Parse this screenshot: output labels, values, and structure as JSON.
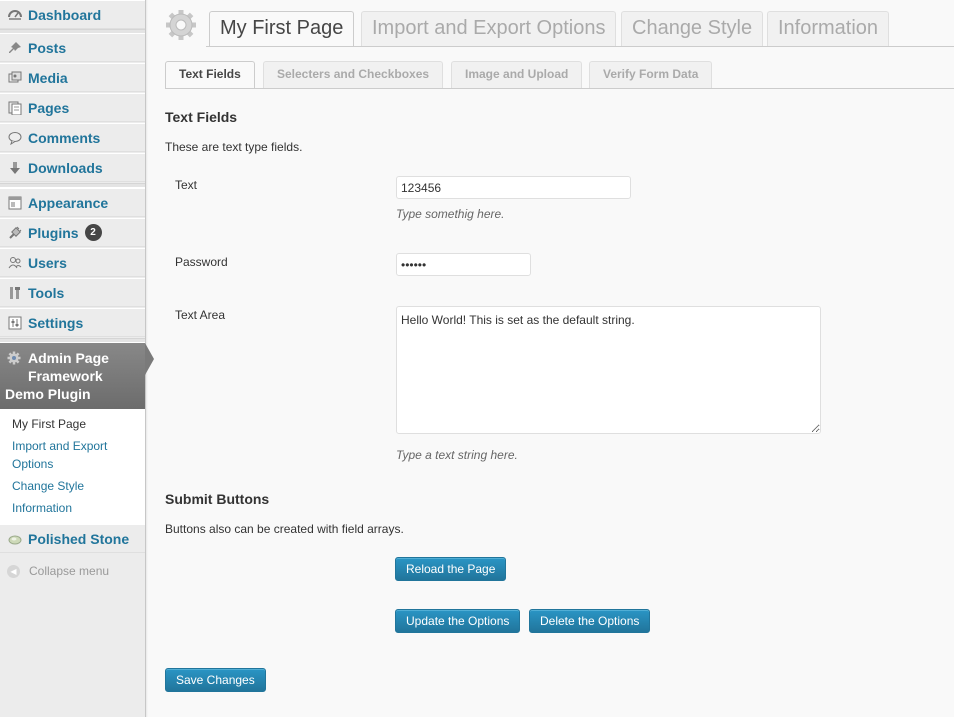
{
  "sidebar": {
    "items": [
      {
        "label": "Dashboard",
        "icon": "dashboard-icon"
      },
      {
        "label": "Posts",
        "icon": "pushpin-icon"
      },
      {
        "label": "Media",
        "icon": "media-icon"
      },
      {
        "label": "Pages",
        "icon": "pages-icon"
      },
      {
        "label": "Comments",
        "icon": "comment-icon"
      },
      {
        "label": "Downloads",
        "icon": "download-icon"
      },
      {
        "label": "Appearance",
        "icon": "appearance-icon"
      },
      {
        "label": "Plugins",
        "icon": "plugin-icon",
        "badge": "2"
      },
      {
        "label": "Users",
        "icon": "users-icon"
      },
      {
        "label": "Tools",
        "icon": "tools-icon"
      },
      {
        "label": "Settings",
        "icon": "settings-icon"
      }
    ],
    "current_menu": {
      "line1": "Admin Page",
      "line2": "Framework",
      "line3": "Demo Plugin"
    },
    "submenu": [
      {
        "label": "My First Page"
      },
      {
        "label": "Import and Export"
      },
      {
        "label": "Options"
      },
      {
        "label": "Change Style"
      },
      {
        "label": "Information"
      }
    ],
    "theme_item": {
      "label": "Polished Stone",
      "icon": "polished-stone-icon"
    },
    "collapse_label": "Collapse menu",
    "accent": "#21759b"
  },
  "page_tabs": [
    {
      "label": "My First Page",
      "active": true
    },
    {
      "label": "Import and Export Options",
      "active": false
    },
    {
      "label": "Change Style",
      "active": false
    },
    {
      "label": "Information",
      "active": false
    }
  ],
  "sub_tabs": [
    {
      "label": "Text Fields",
      "active": true
    },
    {
      "label": "Selecters and Checkboxes",
      "active": false
    },
    {
      "label": "Image and Upload",
      "active": false
    },
    {
      "label": "Verify Form Data",
      "active": false
    }
  ],
  "text_section": {
    "heading": "Text Fields",
    "description": "These are text type fields.",
    "fields": {
      "text": {
        "label": "Text",
        "value": "123456",
        "hint": "Type somethig here."
      },
      "password": {
        "label": "Password",
        "value": "123456"
      },
      "textarea": {
        "label": "Text Area",
        "value": "Hello World! This is set as the default string.",
        "hint": "Type a text string here."
      }
    }
  },
  "submit_section": {
    "heading": "Submit Buttons",
    "description": "Buttons also can be created with field arrays.",
    "reload_label": "Reload the Page",
    "update_label": "Update the Options",
    "delete_label": "Delete the Options"
  },
  "save_label": "Save Changes"
}
